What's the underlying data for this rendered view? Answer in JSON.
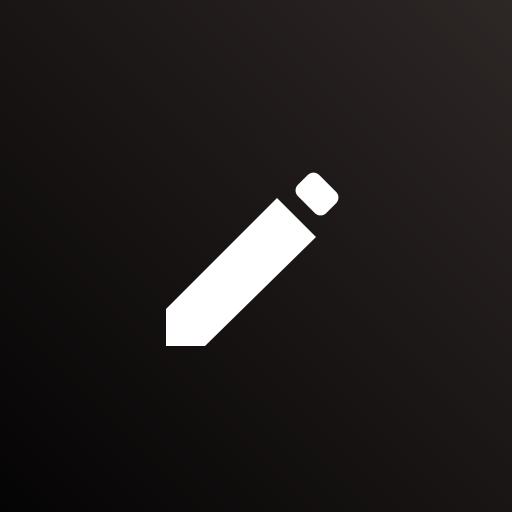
{
  "icon": {
    "name": "pencil-icon",
    "color": "#ffffff"
  },
  "background": {
    "colors": [
      "#2d2726",
      "#1b1716",
      "#050404"
    ]
  }
}
